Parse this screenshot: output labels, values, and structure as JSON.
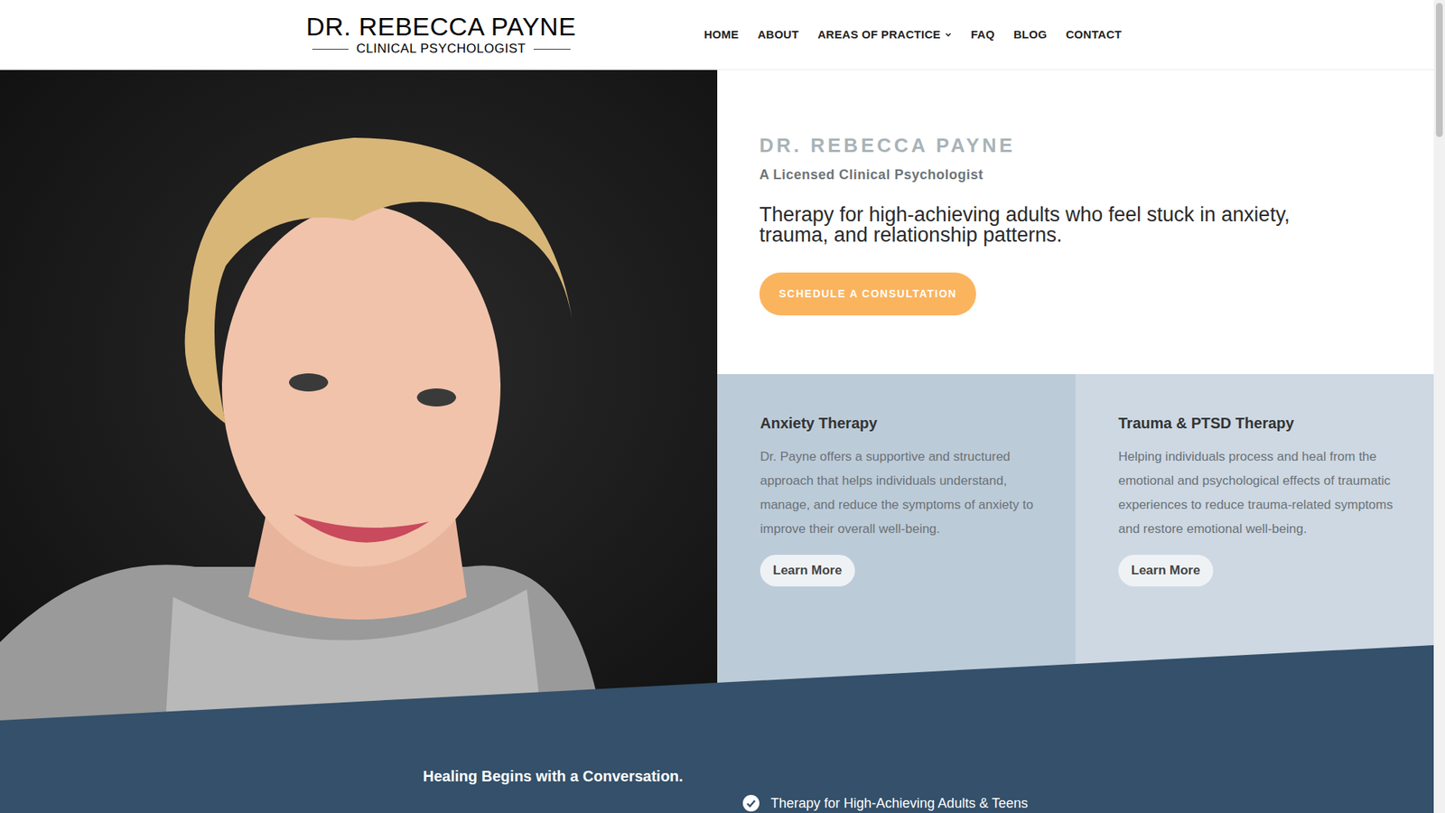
{
  "logo": {
    "name": "DR. REBECCA PAYNE",
    "subtitle": "CLINICAL PSYCHOLOGIST"
  },
  "nav": [
    {
      "label": "HOME",
      "dropdown": false
    },
    {
      "label": "ABOUT",
      "dropdown": false
    },
    {
      "label": "AREAS OF PRACTICE",
      "dropdown": true
    },
    {
      "label": "FAQ",
      "dropdown": false
    },
    {
      "label": "BLOG",
      "dropdown": false
    },
    {
      "label": "CONTACT",
      "dropdown": false
    }
  ],
  "hero": {
    "name": "DR. REBECCA PAYNE",
    "title": "A Licensed Clinical Psychologist",
    "tagline": "Therapy for high-achieving adults who feel stuck in anxiety, trauma, and relationship patterns.",
    "button": "SCHEDULE A CONSULTATION"
  },
  "cards": [
    {
      "title": "Anxiety Therapy",
      "text": "Dr. Payne offers a supportive and structured approach that helps individuals understand, manage, and reduce the symptoms of anxiety to improve their overall well-being.",
      "button": "Learn More",
      "color": "#bccbd8"
    },
    {
      "title": "Trauma & PTSD Therapy",
      "text": "Helping individuals process and heal from the emotional and psychological effects of traumatic experiences to reduce trauma-related symptoms and restore emotional well-being.",
      "button": "Learn More",
      "color": "#cdd8e2"
    }
  ],
  "section": {
    "eyebrow": "Healing Begins with a Conversation.",
    "checklist": [
      "Therapy for High-Achieving Adults & Teens"
    ]
  }
}
